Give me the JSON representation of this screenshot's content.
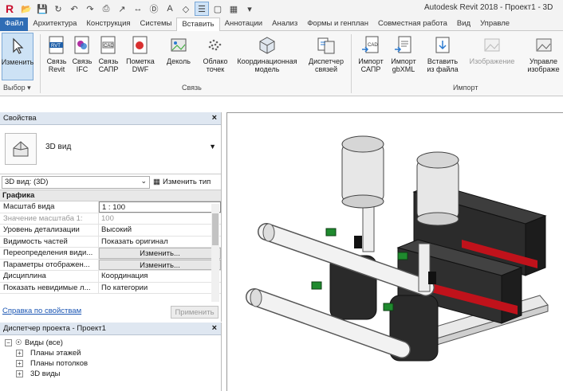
{
  "app": {
    "title": "Autodesk Revit 2018 -    Проект1 - 3D"
  },
  "tabs": [
    "Файл",
    "Архитектура",
    "Конструкция",
    "Системы",
    "Вставить",
    "Аннотации",
    "Анализ",
    "Формы и генплан",
    "Совместная работа",
    "Вид",
    "Управле"
  ],
  "ribbon": {
    "buttons": {
      "modify": "Изменить",
      "link_revit": "Связь\nRevit",
      "link_ifc": "Связь\nIFC",
      "link_cad": "Связь\nСАПР",
      "dwf": "Пометка\nDWF",
      "decal": "Деколь",
      "point_cloud": "Облако\nточек",
      "coord_model": "Координационная\nмодель",
      "link_manager": "Диспетчер\nсвязей",
      "import_cad": "Импорт\nСАПР",
      "import_gbxml": "Импорт\ngbXML",
      "insert_file": "Вставить\nиз файла",
      "image": "Изображение",
      "manage_images": "Управле\nизображе"
    },
    "groups": {
      "select": "Выбор",
      "link": "Связь",
      "import": "Импорт"
    }
  },
  "properties": {
    "title": "Свойства",
    "type_name": "3D вид",
    "filter": "3D вид: (3D)",
    "edit_type": "Изменить тип",
    "category": "Графика",
    "rows": [
      {
        "key": "Масштаб вида",
        "value": "1 : 100"
      },
      {
        "key": "Значение масштаба    1:",
        "value": "100"
      },
      {
        "key": "Уровень детализации",
        "value": "Высокий"
      },
      {
        "key": "Видимость частей",
        "value": "Показать оригинал"
      },
      {
        "key": "Переопределения види...",
        "value": "Изменить..."
      },
      {
        "key": "Параметры отображен...",
        "value": "Изменить..."
      },
      {
        "key": "Дисциплина",
        "value": "Координация"
      },
      {
        "key": "Показать невидимые л...",
        "value": "По категории"
      }
    ],
    "help_link": "Справка по свойствам",
    "apply": "Применить"
  },
  "browser": {
    "title": "Диспетчер проекта - Проект1",
    "items": [
      "Виды (все)",
      "Планы этажей",
      "Планы потолков",
      "3D виды"
    ]
  },
  "colors": {
    "file_tab": "#2f6db5",
    "panel_header": "#dfe7f1",
    "pump_red": "#c0121b",
    "valve_green": "#1f8a2e"
  }
}
